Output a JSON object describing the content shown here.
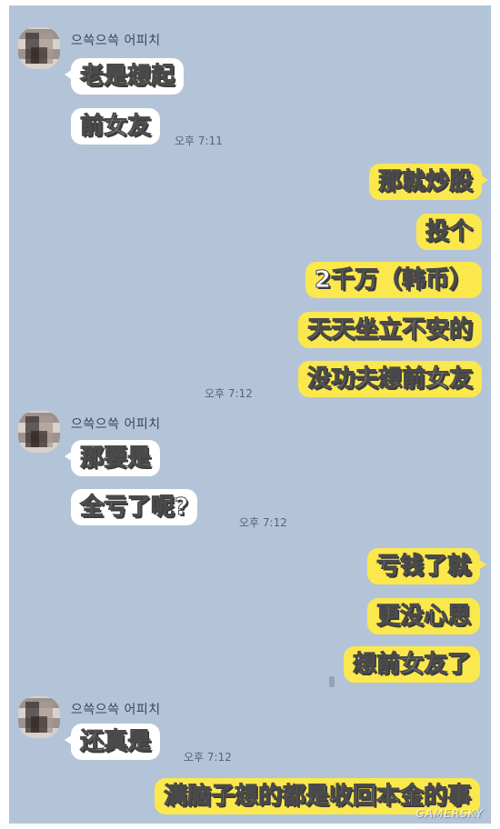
{
  "chat": {
    "sender_name": "으쓱으쓱 어피치",
    "messages": [
      {
        "from": "in",
        "text": "老是想起"
      },
      {
        "from": "in",
        "text": "前女友",
        "time": "오후 7:11"
      },
      {
        "from": "out",
        "text": "那就炒股"
      },
      {
        "from": "out",
        "text": "投个"
      },
      {
        "from": "out",
        "text": "2千万（韩币）"
      },
      {
        "from": "out",
        "text": "天天坐立不安的"
      },
      {
        "from": "out",
        "text": "没功夫想前女友",
        "time": "오후 7:12"
      },
      {
        "from": "in",
        "text": "那要是"
      },
      {
        "from": "in",
        "text": "全亏了呢?",
        "time": "오후 7:12"
      },
      {
        "from": "out",
        "text": "亏钱了就"
      },
      {
        "from": "out",
        "text": "更没心思"
      },
      {
        "from": "out",
        "text": "想前女友了"
      },
      {
        "from": "in",
        "text": "还真是",
        "time": "오후 7:12"
      },
      {
        "from": "out",
        "text": "满脑子想的都是收回本金的事"
      }
    ]
  },
  "watermark": "GAMERSKY",
  "colors": {
    "chat_background": "#b3c4d8",
    "incoming_bubble": "#ffffff",
    "outgoing_bubble": "#fbe84c"
  }
}
